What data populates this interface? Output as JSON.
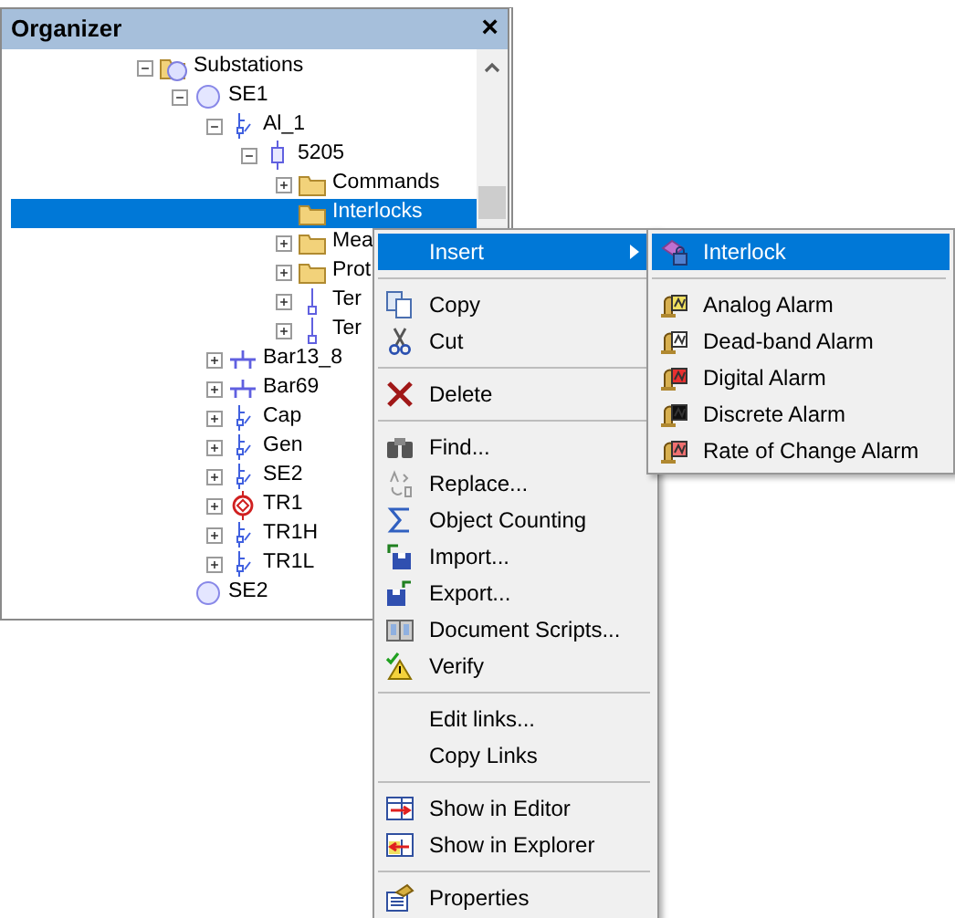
{
  "panel": {
    "title": "Organizer",
    "close": "×"
  },
  "tree": [
    {
      "label": "Substations",
      "kind": "substations",
      "expanded": true,
      "selected": false,
      "children": [
        {
          "label": "SE1",
          "kind": "circle",
          "expanded": true,
          "selected": false,
          "children": [
            {
              "label": "Al_1",
              "kind": "switch",
              "expanded": true,
              "selected": false,
              "children": [
                {
                  "label": "5205",
                  "kind": "node",
                  "expanded": true,
                  "selected": false,
                  "children": [
                    {
                      "label": "Commands",
                      "kind": "folder",
                      "expanded": false,
                      "selected": false
                    },
                    {
                      "label": "Interlocks",
                      "kind": "folder",
                      "selected": true
                    },
                    {
                      "label": "Mea",
                      "kind": "folder",
                      "expanded": false,
                      "selected": false
                    },
                    {
                      "label": "Prot",
                      "kind": "folder",
                      "expanded": false,
                      "selected": false
                    },
                    {
                      "label": "Ter",
                      "kind": "terminal",
                      "expanded": false,
                      "selected": false
                    },
                    {
                      "label": "Ter",
                      "kind": "terminal",
                      "expanded": false,
                      "selected": false
                    }
                  ]
                }
              ]
            },
            {
              "label": "Bar13_8",
              "kind": "bar",
              "expanded": false,
              "selected": false
            },
            {
              "label": "Bar69",
              "kind": "bar",
              "expanded": false,
              "selected": false
            },
            {
              "label": "Cap",
              "kind": "switch",
              "expanded": false,
              "selected": false
            },
            {
              "label": "Gen",
              "kind": "switch",
              "expanded": false,
              "selected": false
            },
            {
              "label": "SE2",
              "kind": "switch",
              "expanded": false,
              "selected": false
            },
            {
              "label": "TR1",
              "kind": "transformer",
              "expanded": false,
              "selected": false
            },
            {
              "label": "TR1H",
              "kind": "switch",
              "expanded": false,
              "selected": false
            },
            {
              "label": "TR1L",
              "kind": "switch",
              "expanded": false,
              "selected": false
            }
          ]
        },
        {
          "label": "SE2",
          "kind": "circle",
          "selected": false
        }
      ]
    }
  ],
  "context_menu": [
    {
      "kind": "plain",
      "label": "Insert",
      "submenu": true,
      "selected": true
    },
    {
      "kind": "separator"
    },
    {
      "kind": "copy",
      "label": "Copy",
      "selected": false
    },
    {
      "kind": "cut",
      "label": "Cut",
      "selected": false
    },
    {
      "kind": "separator"
    },
    {
      "kind": "delete",
      "label": "Delete",
      "selected": false
    },
    {
      "kind": "separator"
    },
    {
      "kind": "find",
      "label": "Find...",
      "selected": false
    },
    {
      "kind": "replace",
      "label": "Replace...",
      "selected": false
    },
    {
      "kind": "sigma",
      "label": "Object Counting",
      "selected": false
    },
    {
      "kind": "import",
      "label": "Import...",
      "selected": false
    },
    {
      "kind": "export",
      "label": "Export...",
      "selected": false
    },
    {
      "kind": "book",
      "label": "Document Scripts...",
      "selected": false
    },
    {
      "kind": "verify",
      "label": "Verify",
      "selected": false
    },
    {
      "kind": "separator"
    },
    {
      "kind": "plain",
      "label": "Edit links...",
      "selected": false
    },
    {
      "kind": "plain",
      "label": "Copy Links",
      "selected": false
    },
    {
      "kind": "separator"
    },
    {
      "kind": "editor",
      "label": "Show in Editor",
      "selected": false
    },
    {
      "kind": "explorer",
      "label": "Show in Explorer",
      "selected": false
    },
    {
      "kind": "separator"
    },
    {
      "kind": "properties",
      "label": "Properties",
      "selected": false
    }
  ],
  "submenu": [
    {
      "kind": "interlock",
      "label": "Interlock",
      "selected": true
    },
    {
      "kind": "separator"
    },
    {
      "kind": "alarm",
      "label": "Analog Alarm",
      "color": "#f0e060",
      "selected": false
    },
    {
      "kind": "alarm",
      "label": "Dead-band Alarm",
      "color": "#ffffff",
      "selected": false
    },
    {
      "kind": "alarm",
      "label": "Digital Alarm",
      "color": "#e83030",
      "selected": false
    },
    {
      "kind": "alarm",
      "label": "Discrete Alarm",
      "color": "#101010",
      "selected": false
    },
    {
      "kind": "alarm",
      "label": "Rate of Change Alarm",
      "color": "#f07070",
      "selected": false
    }
  ]
}
